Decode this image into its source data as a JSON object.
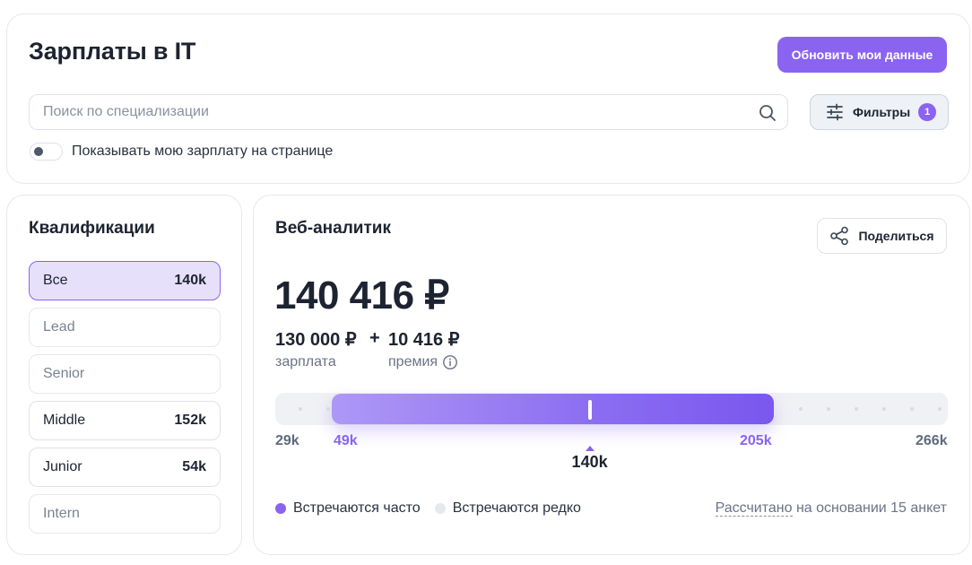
{
  "header": {
    "title": "Зарплаты в IT",
    "update_button": "Обновить мои данные",
    "search_placeholder": "Поиск по специализации",
    "filters_label": "Фильтры",
    "filters_count": "1",
    "toggle_label": "Показывать мою зарплату на странице",
    "toggle_on": false
  },
  "qualifications": {
    "title": "Квалификации",
    "items": [
      {
        "name": "Все",
        "value": "140k",
        "state": "active"
      },
      {
        "name": "Lead",
        "value": "",
        "state": "disabled"
      },
      {
        "name": "Senior",
        "value": "",
        "state": "disabled"
      },
      {
        "name": "Middle",
        "value": "152k",
        "state": "available"
      },
      {
        "name": "Junior",
        "value": "54k",
        "state": "available"
      },
      {
        "name": "Intern",
        "value": "",
        "state": "disabled"
      }
    ]
  },
  "main": {
    "role": "Веб-аналитик",
    "share_label": "Поделиться",
    "total": "140 416 ₽",
    "salary_value": "130 000 ₽",
    "salary_label": "зарплата",
    "plus": "+",
    "bonus_value": "10 416 ₽",
    "bonus_label": "премия",
    "range": {
      "min": 29,
      "max": 266,
      "min_label": "29k",
      "max_label": "266k",
      "low": 49,
      "high": 205,
      "low_label": "49k",
      "high_label": "205k",
      "median": 140,
      "median_label": "140k"
    },
    "legend": {
      "often": "Встречаются часто",
      "rare": "Встречаются редко"
    },
    "basis_link": "Рассчитано",
    "basis_text": " на основании 15 анкет"
  },
  "colors": {
    "accent": "#8a63f0",
    "rare_dot": "#e6e8ee"
  }
}
